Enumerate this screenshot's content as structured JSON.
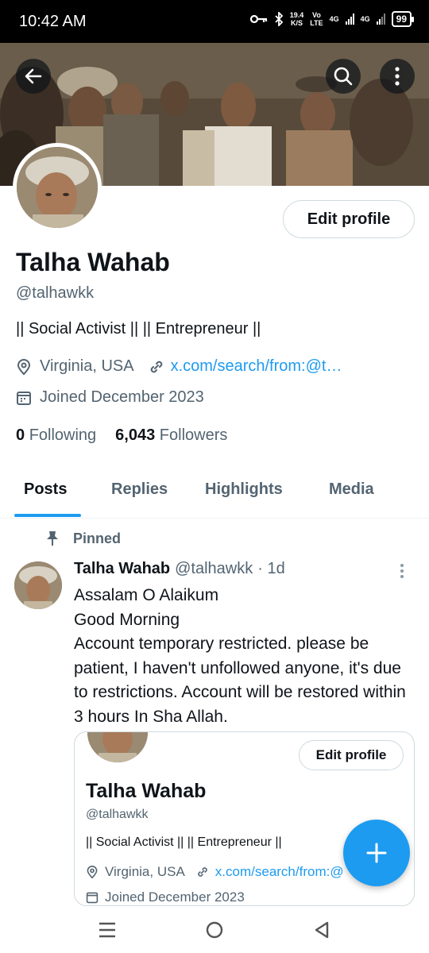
{
  "status_bar": {
    "time": "10:42 AM",
    "speed_value": "19.4",
    "speed_unit": "K/S",
    "vo": "Vo",
    "lte": "LTE",
    "net1": "4G",
    "net2": "4G",
    "battery": "99"
  },
  "profile": {
    "name": "Talha Wahab",
    "handle": "@talhawkk",
    "bio": "|| Social Activist || || Entrepreneur ||",
    "location": "Virginia, USA",
    "link": "x.com/search/from:@t…",
    "joined": "Joined December 2023",
    "following_count": "0",
    "following_label": "Following",
    "followers_count": "6,043",
    "followers_label": "Followers",
    "edit_profile_label": "Edit profile"
  },
  "tabs": [
    {
      "label": "Posts",
      "active": true
    },
    {
      "label": "Replies",
      "active": false
    },
    {
      "label": "Highlights",
      "active": false
    },
    {
      "label": "Media",
      "active": false
    }
  ],
  "post": {
    "pinned_label": "Pinned",
    "author": "Talha Wahab",
    "handle": "@talhawkk",
    "time": "· 1d",
    "text": "Assalam O Alaikum\nGood Morning\nAccount temporary restricted. please be patient, I haven't unfollowed anyone, it's due to restrictions. Account will be restored within 3 hours In Sha Allah."
  },
  "embed": {
    "edit_profile_label": "Edit profile",
    "name": "Talha Wahab",
    "handle": "@talhawkk",
    "bio": "|| Social Activist || || Entrepreneur ||",
    "location": "Virginia, USA",
    "link": "x.com/search/from:@",
    "joined": "Joined December 2023"
  },
  "colors": {
    "accent": "#1d9bf0",
    "text_primary": "#0f1419",
    "text_secondary": "#536471"
  },
  "icons": [
    "back-arrow-icon",
    "search-icon",
    "more-vertical-icon",
    "location-pin-icon",
    "link-icon",
    "calendar-icon",
    "pin-icon",
    "plus-icon",
    "menu-icon",
    "home-circle-icon",
    "back-triangle-icon"
  ]
}
